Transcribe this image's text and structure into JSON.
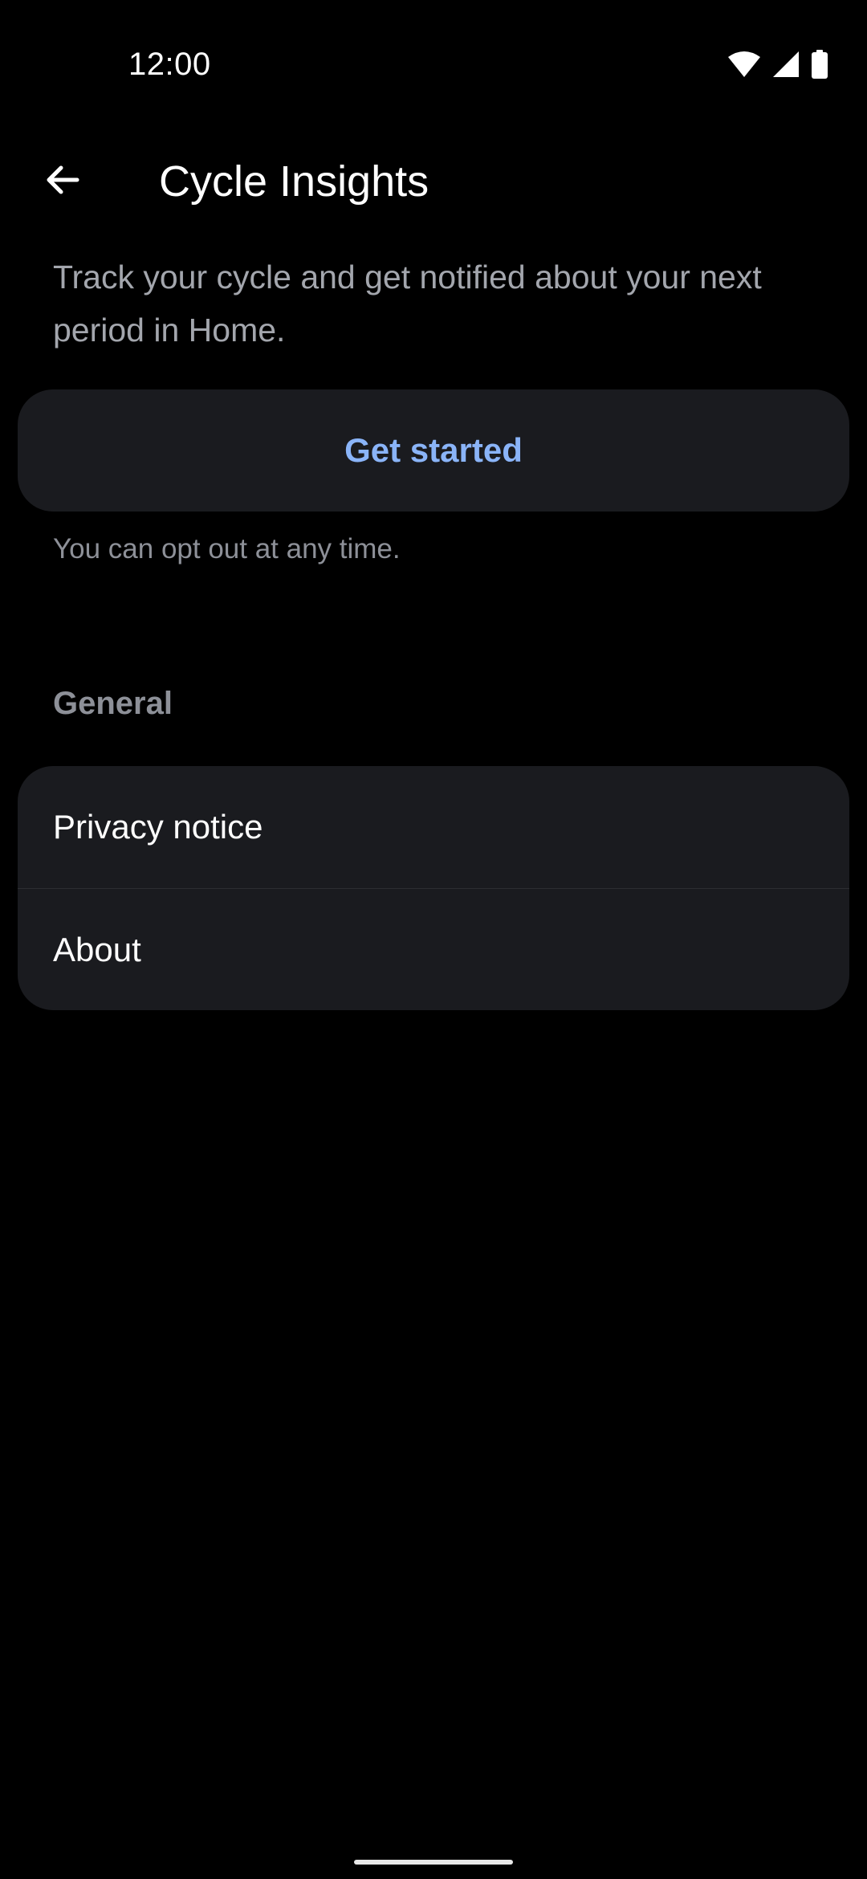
{
  "status_bar": {
    "time": "12:00",
    "icons": [
      "wifi-icon",
      "cellular-signal-icon",
      "battery-icon"
    ]
  },
  "app_bar": {
    "back_icon": "arrow-back-icon",
    "title": "Cycle Insights"
  },
  "intro": {
    "description": "Track your cycle and get notified about your next period in Home.",
    "primary_button_label": "Get started",
    "optout_note": "You can opt out at any time."
  },
  "general_section": {
    "header": "General",
    "items": [
      {
        "label": "Privacy notice"
      },
      {
        "label": "About"
      }
    ]
  },
  "colors": {
    "background": "#000000",
    "card": "#1a1b1f",
    "accent": "#8ab4f8",
    "secondary_text": "#8d9098"
  }
}
